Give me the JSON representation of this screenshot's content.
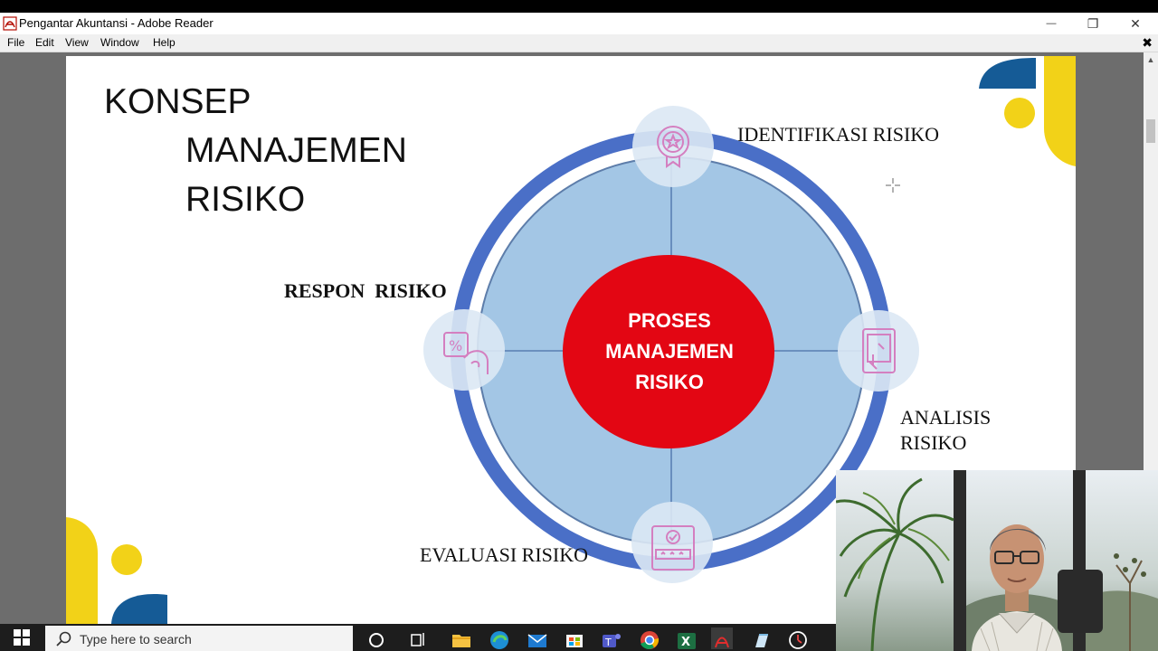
{
  "window": {
    "title": "Pengantar Akuntansi - Adobe Reader",
    "minimize_glyph": "—",
    "restore_glyph": "❐",
    "close_glyph": "✕"
  },
  "menu": {
    "items": [
      "File",
      "Edit",
      "View",
      "Window",
      "Help"
    ],
    "doc_close": "✖"
  },
  "slide": {
    "title_line1": "KONSEP",
    "title_line2": "MANAJEMEN",
    "title_line3": "RISIKO",
    "center_line1": "PROSES",
    "center_line2": "MANAJEMEN",
    "center_line3": "RISIKO",
    "label_identifikasi": "IDENTIFIKASI RISIKO",
    "label_respon": "RESPON  RISIKO",
    "label_analisis_1": "ANALISIS",
    "label_analisis_2": "RISIKO",
    "label_evaluasi": "EVALUASI RISIKO",
    "colors": {
      "ring_outer": "#4a6fc7",
      "ring_inner": "#a3c6e5",
      "center": "#e30613",
      "icon": "#d47fc0",
      "accent_yellow": "#f2d218",
      "accent_blue": "#155b96"
    }
  },
  "taskbar": {
    "search_placeholder": "Type here to search",
    "icons": [
      "cortana-icon",
      "task-view-icon",
      "file-explorer-icon",
      "edge-icon",
      "mail-icon",
      "store-icon",
      "teams-icon",
      "chrome-icon",
      "excel-icon",
      "acrobat-icon",
      "notepad-icon",
      "clock-app-icon"
    ]
  }
}
